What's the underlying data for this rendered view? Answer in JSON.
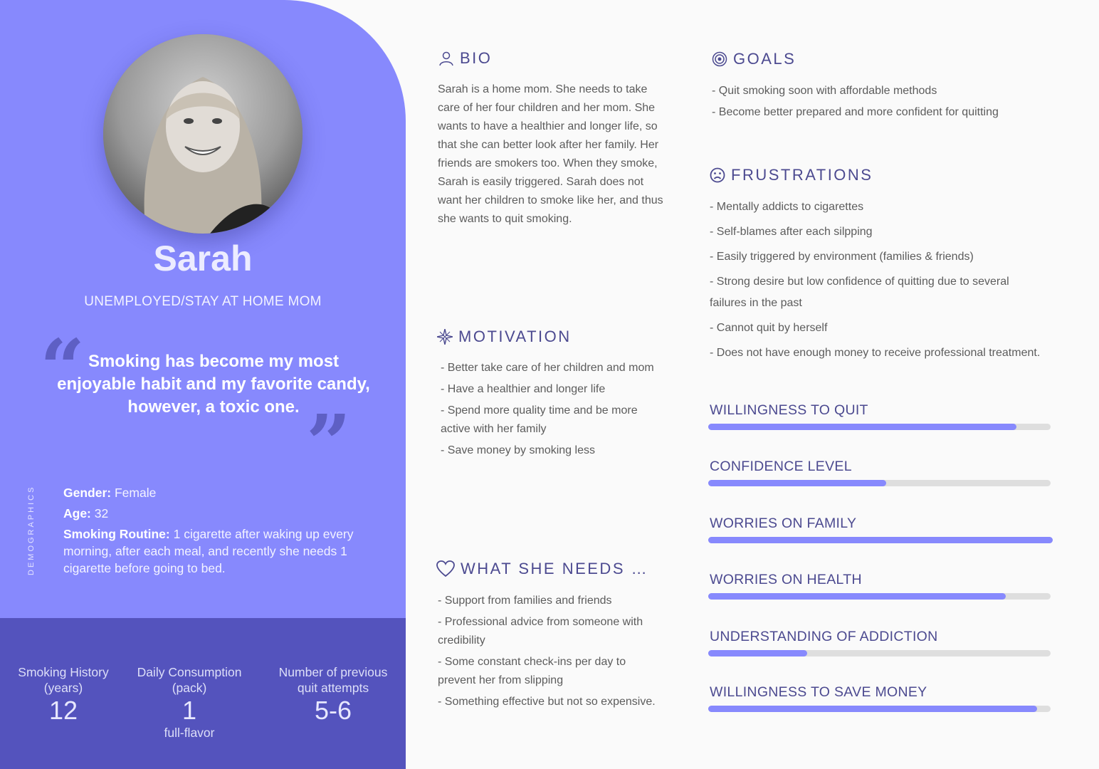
{
  "profile": {
    "name": "Sarah",
    "role": "UNEMPLOYED/STAY AT HOME MOM",
    "quote": "Smoking has become my most enjoyable habit and my favorite candy, however, a toxic one."
  },
  "demographics": {
    "label": "DEMOGRAPHICS",
    "gender_label": "Gender:",
    "gender": "Female",
    "age_label": "Age:",
    "age": "32",
    "routine_label": "Smoking Routine:",
    "routine": "1 cigarette after waking up every morning, after each meal, and recently she needs 1 cigarette before going to bed."
  },
  "stats": [
    {
      "label_1": "Smoking History",
      "label_2": "(years)",
      "value": "12",
      "sub": ""
    },
    {
      "label_1": "Daily Consumption",
      "label_2": "(pack)",
      "value": "1",
      "sub": "full-flavor"
    },
    {
      "label_1": "Number of previous",
      "label_2": "quit attempts",
      "value": "5-6",
      "sub": ""
    }
  ],
  "bio": {
    "heading": "BIO",
    "lines": [
      "Sarah is a home mom. She needs to take",
      "care of her four children and her mom. She",
      "wants to have a healthier and longer life, so",
      "that she can better look after her family. Her",
      "friends are smokers too. When they smoke,",
      "Sarah is easily triggered. Sarah does not",
      "want her children to smoke like her, and thus",
      "she wants to quit smoking."
    ]
  },
  "motivation": {
    "heading": "MOTIVATION",
    "items": [
      "- Better take care of her children and mom",
      "- Have a healthier and longer life",
      "- Spend more quality time and be more",
      "active with her family",
      "- Save money by smoking less"
    ]
  },
  "needs": {
    "heading": "WHAT SHE NEEDS …",
    "items": [
      "- Support from families and friends",
      "- Professional advice from someone with",
      "credibility",
      "- Some constant check-ins per day to",
      "prevent her from slipping",
      "- Something effective but not so expensive."
    ]
  },
  "goals": {
    "heading": "GOALS",
    "items": [
      "- Quit smoking soon with affordable methods",
      "- Become better prepared and more confident for quitting"
    ]
  },
  "frustrations": {
    "heading": "FRUSTRATIONS",
    "items": [
      "- Mentally addicts to cigarettes",
      "- Self-blames after each silpping",
      "- Easily triggered by environment (families & friends)",
      "- Strong desire but low confidence of quitting due to several",
      "failures in the past",
      "- Cannot quit by herself",
      "- Does not have enough money to receive professional treatment."
    ]
  },
  "meters": [
    {
      "label": "WILLINGNESS TO QUIT",
      "value": 0.9
    },
    {
      "label": "CONFIDENCE LEVEL",
      "value": 0.52
    },
    {
      "label": "WORRIES ON FAMILY",
      "value": 1.0
    },
    {
      "label": "WORRIES ON HEALTH",
      "value": 0.87
    },
    {
      "label": "UNDERSTANDING OF ADDICTION",
      "value": 0.29
    },
    {
      "label": "WILLINGNESS TO SAVE MONEY",
      "value": 0.96
    }
  ],
  "colors": {
    "accent": "#8789fd",
    "accent_dark": "#5453bd",
    "heading": "#4c4a90",
    "track": "#dedede"
  }
}
